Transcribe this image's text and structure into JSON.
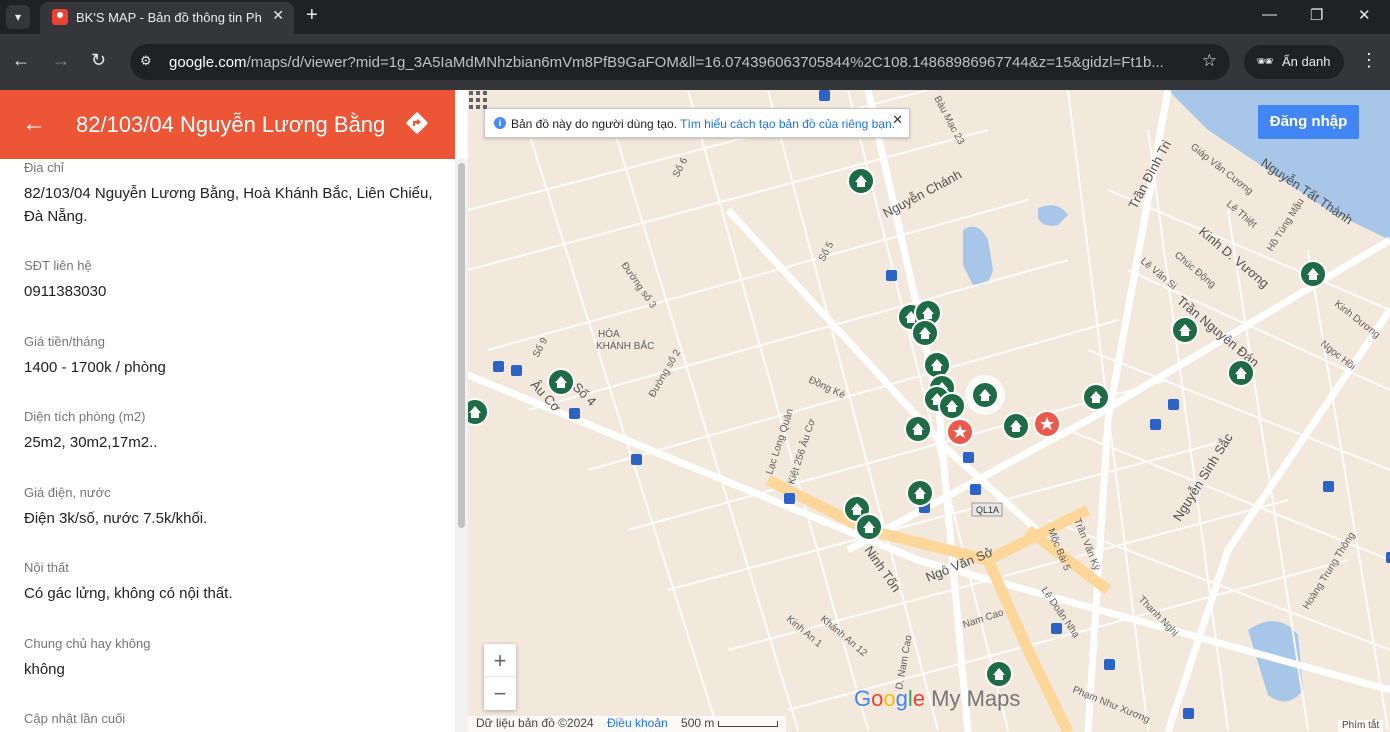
{
  "browser": {
    "tab_title": "BK'S MAP - Bản đồ thông tin Ph",
    "url_host": "google.com",
    "url_path": "/maps/d/viewer?mid=1g_3A5IaMdMNhzbian6mVm8PfB9GaFOM&ll=16.074396063705844%2C108.14868986967744&z=15&gidzl=Ft1b...",
    "incognito_label": "Ẩn danh"
  },
  "panel": {
    "title": "82/103/04 Nguyễn Lương Bằng",
    "fields": [
      {
        "label": "Địa chỉ",
        "value": "82/103/04 Nguyễn Lương Bằng, Hoà Khánh Bắc, Liên Chiểu, Đà Nẵng."
      },
      {
        "label": "SĐT liên hệ",
        "value": "0911383030"
      },
      {
        "label": "Giá tiền/tháng",
        "value": "1400 - 1700k / phòng"
      },
      {
        "label": "Diện tích phòng (m2)",
        "value": "25m2, 30m2,17m2.."
      },
      {
        "label": "Giá điện, nước",
        "value": "Điện 3k/số, nước 7.5k/khối."
      },
      {
        "label": "Nội thất",
        "value": "Có gác lửng, không có nội thất."
      },
      {
        "label": "Chung chủ hay không",
        "value": "không"
      },
      {
        "label": "Cập nhật lần cuối",
        "value": ""
      }
    ]
  },
  "map": {
    "notice_text": "Bản đồ này do người dùng tạo.",
    "notice_link": "Tìm hiểu cách tạo bản đồ của riêng bạn.",
    "login_label": "Đăng nhập",
    "zoom_in": "+",
    "zoom_out": "−",
    "logo_g1": "G",
    "logo_g2": "o",
    "logo_g3": "o",
    "logo_g4": "g",
    "logo_g5": "l",
    "logo_g6": "e",
    "logo_suffix": " My Maps",
    "attribution": "Dữ liệu bản đồ ©2024",
    "terms": "Điều khoản",
    "scale": "500 m",
    "shortcuts": "Phím tắt",
    "highway_badge": "QL1A",
    "area_label_1": "HÒA",
    "area_label_2": "KHÁNH BẮC",
    "streets": [
      "Nguyễn Chánh",
      "Bàu Mạc 23",
      "Trần Đình Tri",
      "Giáp Văn Cương",
      "Nguyễn Tất Thành",
      "Kinh D. Vương",
      "Trần Nguyên Đán",
      "Nguyễn Sinh Sắc",
      "Ngô Văn Sở",
      "Ninh Tốn",
      "Âu Cơ",
      "Số 4",
      "Lạc Long Quân",
      "Kiệt 256 Âu Cơ",
      "Hoàng Trung Thông",
      "Thanh Nghị",
      "Phạm Như Xương",
      "Đường số 2",
      "Đường số 3",
      "Đồng Kè",
      "Lê Doãn Nhạ",
      "Mộc Bài 5",
      "Trần Văn Kỳ",
      "Nam Cao",
      "Kinh Dương",
      "Ngọc Hồi",
      "Lê Văn Si",
      "Chúc Động",
      "Lê Thiệt",
      "Hồ Tùng Mậu",
      "Số 6",
      "Số 9",
      "Số 5",
      "Kinh An 1",
      "Khánh An 12",
      "D. Nam Cao"
    ],
    "icon_names": [
      "house-marker-icon",
      "star-marker-icon",
      "bus-stop-icon"
    ],
    "colors": {
      "house_marker": "#1e6b45",
      "star_marker": "#e95a4c",
      "water": "#a7c6e8",
      "road": "#ffffff",
      "highway": "#fdd79a",
      "land": "#f3e8dc"
    }
  }
}
